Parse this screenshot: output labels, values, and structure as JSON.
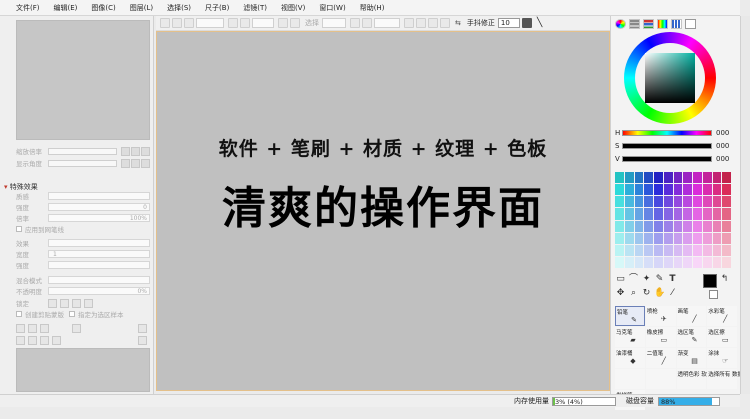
{
  "menu": [
    "文件(F)",
    "编辑(E)",
    "图像(C)",
    "图层(L)",
    "选择(S)",
    "尺子(B)",
    "滤镜(T)",
    "视图(V)",
    "窗口(W)",
    "帮助(H)"
  ],
  "toolbar": {
    "select_label": "选择",
    "stabilizer_label": "手抖修正",
    "stabilizer_value": "10"
  },
  "left_panel": {
    "zoom_label": "缩放倍率",
    "angle_label": "显示角度",
    "effects_header": "特殊效果",
    "texture_label": "质感",
    "strength_label": "强度",
    "scale_label": "倍率",
    "scale_value": "100%",
    "strength_value": "0",
    "apply_label": "应用到网笔线",
    "effect_label": "效果",
    "width_label": "宽度",
    "width_value": "1",
    "effect_strength_label": "强度",
    "blend_mode_label": "混合模式",
    "opacity_label": "不透明度",
    "opacity_value": "0%",
    "lock_label": "锁定",
    "clip_label": "创建剪贴蒙版",
    "select_source_label": "指定为选区样本"
  },
  "canvas": {
    "caption_line1": "软件 + 笔刷 + 材质 + 纹理 + 色板",
    "caption_line2": "清爽的操作界面"
  },
  "color_panel": {
    "h_label": "H",
    "h_value": "000",
    "s_label": "S",
    "s_value": "000",
    "v_label": "V",
    "v_value": "000",
    "foreground_color": "#000000",
    "background_color": "#ffffff"
  },
  "brushes": [
    {
      "label": "铅笔",
      "icon": "pencil-icon",
      "selected": true
    },
    {
      "label": "喷枪",
      "icon": "airbrush-icon",
      "selected": false
    },
    {
      "label": "画笔",
      "icon": "brush-icon",
      "selected": false
    },
    {
      "label": "水彩笔",
      "icon": "watercolor-icon",
      "selected": false
    },
    {
      "label": "马克笔",
      "icon": "marker-icon",
      "selected": false
    },
    {
      "label": "橡皮擦",
      "icon": "eraser-icon",
      "selected": false
    },
    {
      "label": "选区笔",
      "icon": "selection-pen-icon",
      "selected": false
    },
    {
      "label": "选区擦",
      "icon": "selection-eraser-icon",
      "selected": false
    },
    {
      "label": "油漆桶",
      "icon": "bucket-icon",
      "selected": false
    },
    {
      "label": "二值笔",
      "icon": "binary-pen-icon",
      "selected": false
    },
    {
      "label": "渐变",
      "icon": "gradient-icon",
      "selected": false
    },
    {
      "label": "涂抹",
      "icon": "smudge-icon",
      "selected": false
    },
    {
      "label": "",
      "icon": "",
      "selected": false
    },
    {
      "label": "",
      "icon": "",
      "selected": false
    },
    {
      "label": "透明色彩 软笔",
      "icon": "",
      "selected": false
    },
    {
      "label": "选择所有 数据",
      "icon": "",
      "selected": false
    },
    {
      "label": "发样笔",
      "icon": "",
      "selected": false
    }
  ],
  "status": {
    "memory_label": "内存使用量",
    "memory_value": "3% (4%)",
    "memory_fraction": 0.03,
    "disk_label": "磁盘容量",
    "disk_value": "88%",
    "disk_fraction": 0.88,
    "disk_fill_color": "#35aee8"
  }
}
